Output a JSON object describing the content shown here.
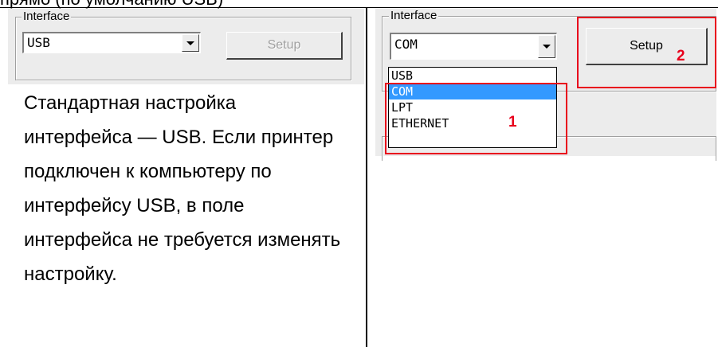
{
  "top_text": "прямо (по умолчанию USB)",
  "left_panel": {
    "group_label": "Interface",
    "combo_value": "USB",
    "setup_label": "Setup"
  },
  "description": "Стандартная настройка интерфейса — USB. Если принтер подключен к компьютеру по интерфейсу USB, в поле интерфейса не требуется изменять настройку.",
  "right_panel": {
    "group_label": "Interface",
    "combo_value": "COM",
    "setup_label": "Setup",
    "options": [
      "USB",
      "COM",
      "LPT",
      "ETHERNET"
    ],
    "selected_index": 1,
    "marker_1": "1",
    "marker_2": "2"
  },
  "colors": {
    "highlight": "#e8001c",
    "selection": "#3399ff",
    "panel": "#ececec"
  }
}
